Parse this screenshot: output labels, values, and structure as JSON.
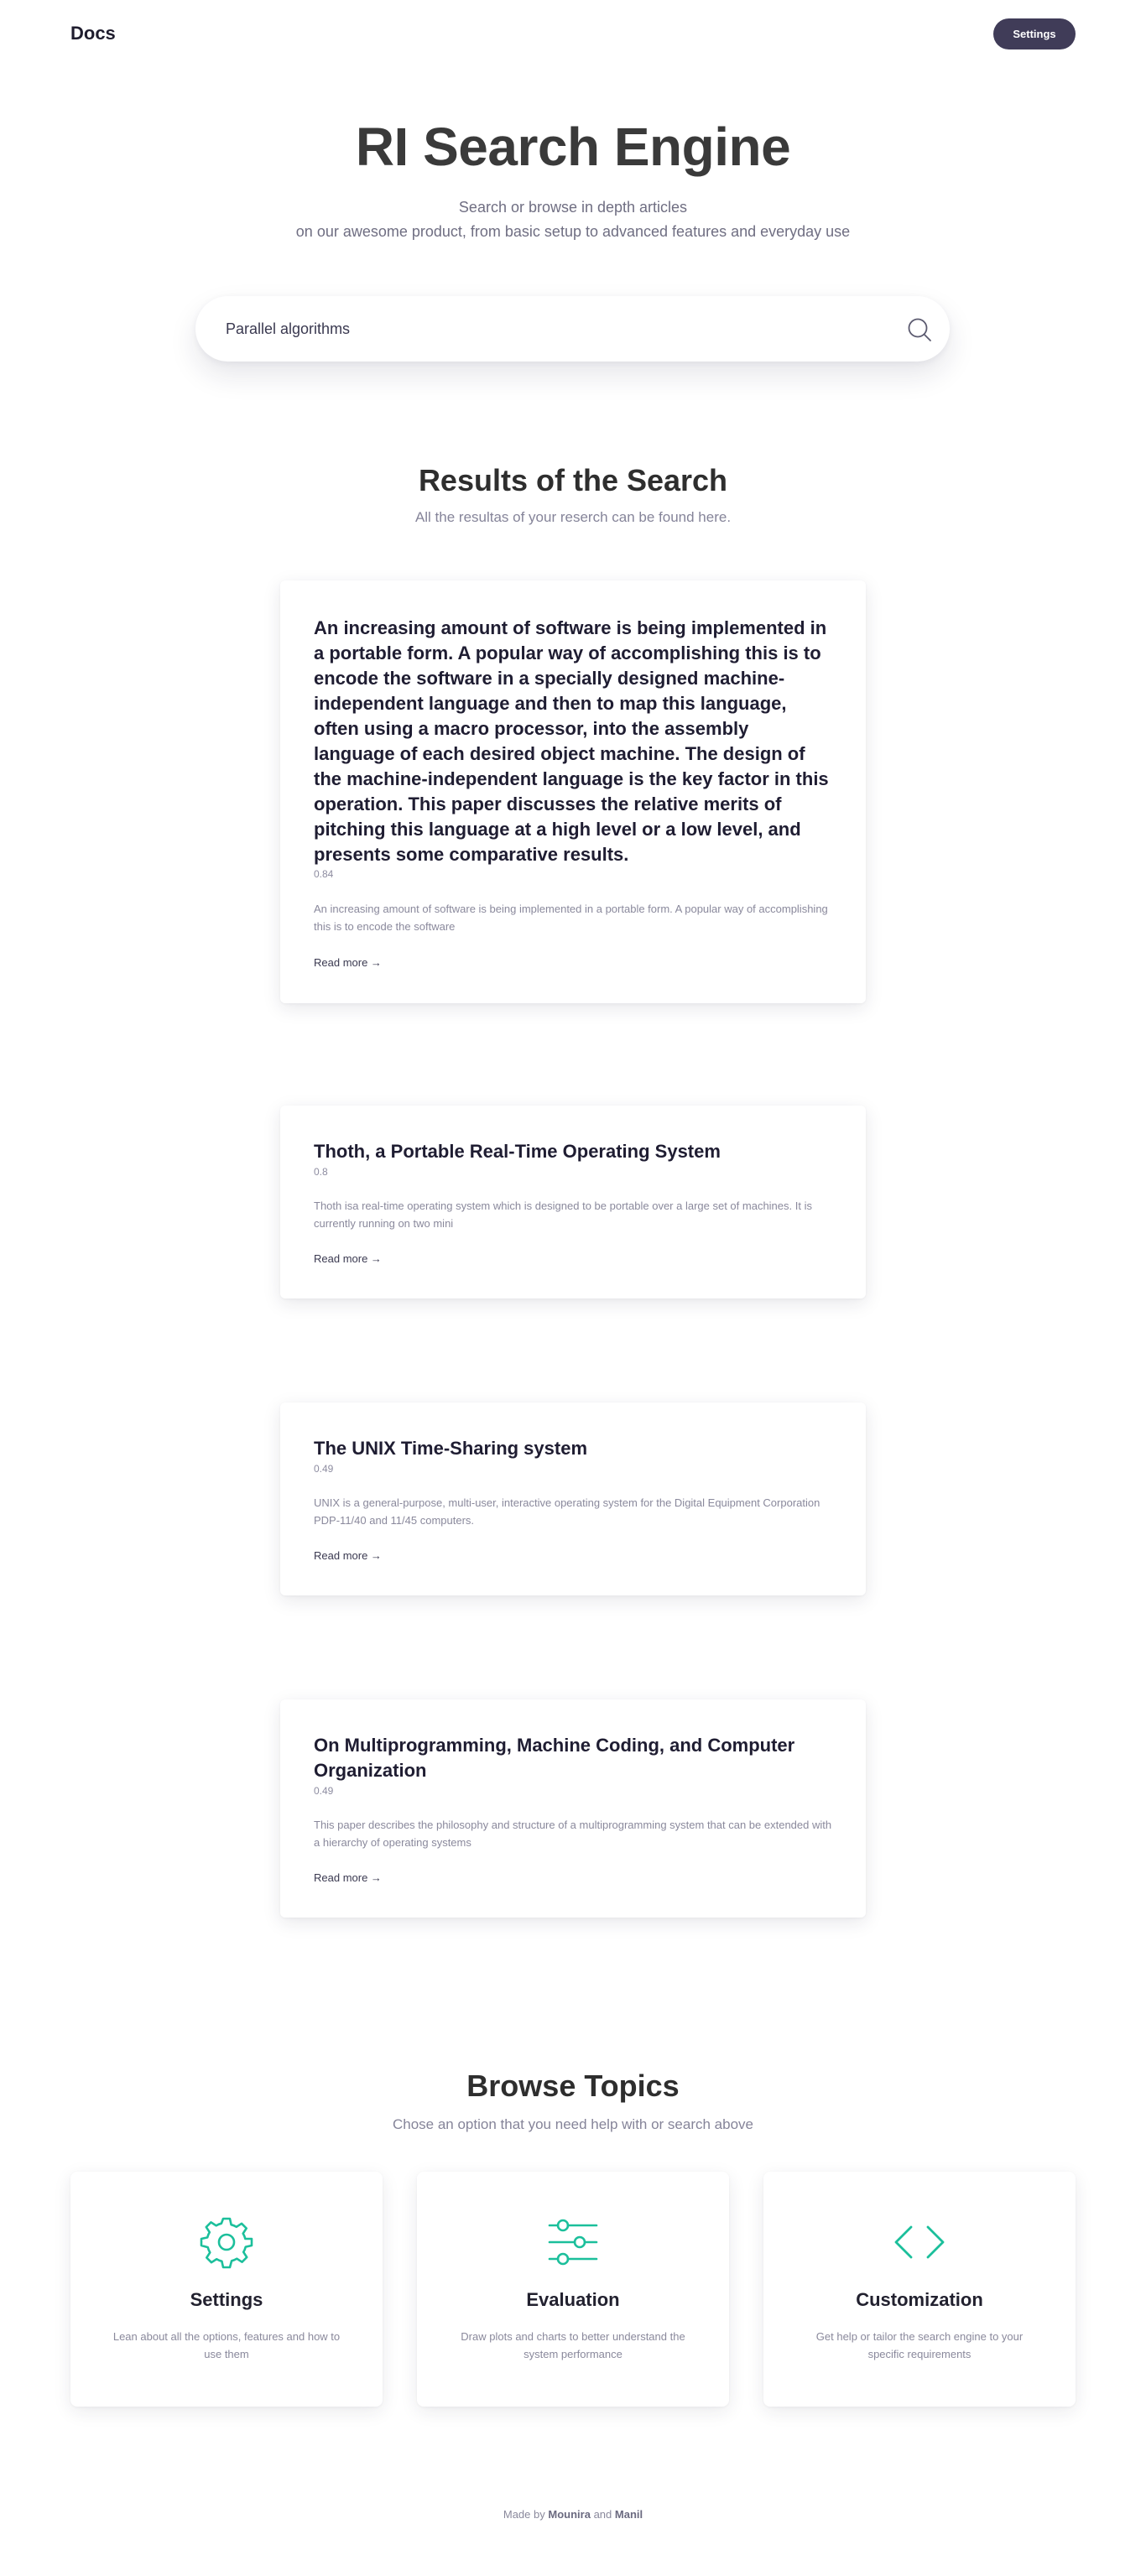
{
  "nav": {
    "logo": "Docs",
    "settings_label": "Settings"
  },
  "hero": {
    "title": "RI Search Engine",
    "subtitle_line1": "Search or browse in depth articles",
    "subtitle_line2": "on our awesome product, from basic setup to advanced features and everyday use"
  },
  "search": {
    "value": "Parallel algorithms",
    "icon": "search-icon"
  },
  "results": {
    "title": "Results of the Search",
    "subtitle": "All the resultas of your reserch can be found here.",
    "read_more_label": "Read more →",
    "items": [
      {
        "title": "An increasing amount of software is being implemented in a portable form. A popular way of accomplishing this is to encode the software in a specially designed machine-independent language and then to map this language, often using a macro processor, into the assembly language of each desired object machine. The design of the machine-independent language is the key factor in this operation. This paper discusses the relative merits of pitching this language at a high level or a low level, and presents some comparative results.",
        "score": "0.84",
        "snippet": "An increasing amount of software is being implemented in a portable form. A popular way of accomplishing this is to encode the software"
      },
      {
        "title": "Thoth, a Portable Real-Time Operating System",
        "score": "0.8",
        "snippet": "Thoth isa real-time operating system which is designed to be portable over a large set of machines. It is currently running on two mini"
      },
      {
        "title": "The UNIX Time-Sharing system",
        "score": "0.49",
        "snippet": "UNIX is a general-purpose, multi-user, interactive operating system for the Digital Equipment Corporation PDP-11/40 and 11/45 computers."
      },
      {
        "title": "On Multiprogramming, Machine Coding, and Computer Organization",
        "score": "0.49",
        "snippet": "This paper describes the philosophy and structure of a multiprogramming system that can be extended with a hierarchy of operating systems"
      }
    ]
  },
  "topics": {
    "title": "Browse Topics",
    "subtitle": "Chose an option that you need help with or search above",
    "accent_color": "#1bbf9b",
    "items": [
      {
        "icon": "gear-icon",
        "title": "Settings",
        "desc": "Lean about all the options, features and how to use them"
      },
      {
        "icon": "sliders-icon",
        "title": "Evaluation",
        "desc": "Draw plots and charts to better understand the system performance"
      },
      {
        "icon": "code-icon",
        "title": "Customization",
        "desc": "Get help or tailor the search engine to your specific requirements"
      }
    ]
  },
  "footer": {
    "prefix": "Made by",
    "author1": "Mounira",
    "joiner": "and",
    "author2": "Manil"
  }
}
